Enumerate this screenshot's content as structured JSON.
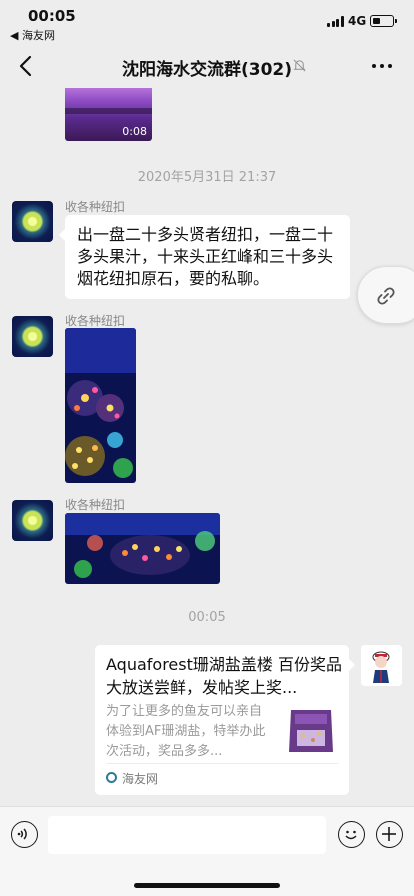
{
  "status_bar": {
    "time": "00:05",
    "back_app": "◀ 海友网",
    "network": "4G"
  },
  "nav": {
    "title": "沈阳海水交流群(302)",
    "back_icon": "chevron-left-icon",
    "mute_icon": "bell-muted-icon",
    "more_icon": "more-dots-icon"
  },
  "chat": {
    "video": {
      "duration": "0:08"
    },
    "timestamp_1": "2020年5月31日 21:37",
    "messages": [
      {
        "sender": "收各种纽扣",
        "text": "出一盘二十多头贤者纽扣，一盘二十多头果汁，十来头正红峰和三十多头烟花纽扣原石，要的私聊。"
      },
      {
        "sender": "收各种纽扣",
        "type": "image"
      },
      {
        "sender": "收各种纽扣",
        "type": "image"
      }
    ],
    "timestamp_2": "00:05",
    "share_card": {
      "title": "Aquaforest珊湖盐盖楼 百份奖品大放送尝鲜，发帖奖上奖...",
      "description": "为了让更多的鱼友可以亲自体验到AF珊湖盐，特举办此次活动，奖品多多...",
      "source": "海友网"
    }
  },
  "input_bar": {
    "placeholder": "",
    "voice_icon": "voice-icon",
    "emoji_icon": "emoji-icon",
    "plus_icon": "plus-icon"
  },
  "colors": {
    "background": "#ededed",
    "bubble": "#ffffff",
    "meta_text": "#a3a3a3"
  }
}
